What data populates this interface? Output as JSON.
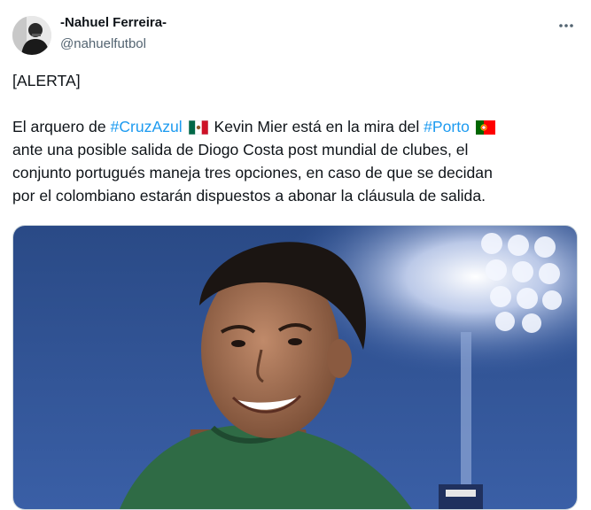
{
  "author": {
    "display_name": "-Nahuel Ferreira-",
    "handle": "@nahuelfutbol",
    "avatar_icon": "person-avatar-icon"
  },
  "more_icon": "ellipsis-icon",
  "tweet": {
    "alert_line": "[ALERTA]",
    "body": {
      "t1": "El arquero de ",
      "hashtag_cruzazul": "#CruzAzul",
      "t2": " Kevin Mier está en la mira del ",
      "hashtag_porto": "#Porto",
      "t3": "ante una posible salida de Diogo Costa post mundial de clubes, el",
      "t4": "conjunto portugués maneja tres opciones, en caso de que se decidan",
      "t5": "por el colombiano estarán dispuestos a abonar la cláusula de salida."
    },
    "flags": [
      "mexico-flag-icon",
      "portugal-flag-icon"
    ]
  },
  "media": {
    "kind": "photo",
    "subject": "football goalkeeper photo"
  },
  "colors": {
    "link": "#1d9bf0",
    "secondary_text": "#536471",
    "primary_text": "#0f1419"
  }
}
